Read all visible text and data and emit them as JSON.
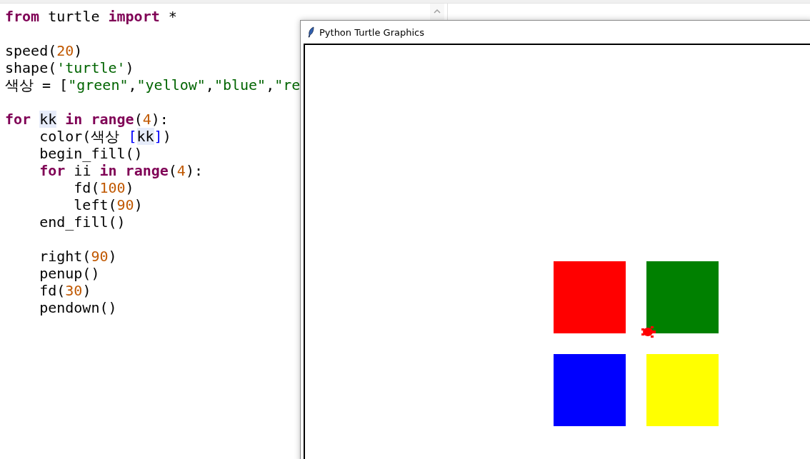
{
  "editor": {
    "blocks": [
      [
        [
          {
            "text": "from",
            "kind": "keyword"
          },
          {
            "text": " turtle ",
            "kind": "plain"
          },
          {
            "text": "import",
            "kind": "keyword"
          },
          {
            "text": " *",
            "kind": "plain"
          }
        ]
      ],
      [
        [
          {
            "text": "speed(",
            "kind": "plain"
          },
          {
            "text": "20",
            "kind": "number"
          },
          {
            "text": ")",
            "kind": "plain"
          }
        ],
        [
          {
            "text": "shape(",
            "kind": "plain"
          },
          {
            "text": "'turtle'",
            "kind": "string"
          },
          {
            "text": ")",
            "kind": "plain"
          }
        ],
        [
          {
            "text": "색상 = [",
            "kind": "plain"
          },
          {
            "text": "\"green\"",
            "kind": "string"
          },
          {
            "text": ",",
            "kind": "plain"
          },
          {
            "text": "\"yellow\"",
            "kind": "string"
          },
          {
            "text": ",",
            "kind": "plain"
          },
          {
            "text": "\"blue\"",
            "kind": "string"
          },
          {
            "text": ",",
            "kind": "plain"
          },
          {
            "text": "\"re",
            "kind": "string"
          }
        ]
      ],
      [
        [
          {
            "text": "for ",
            "kind": "keyword"
          },
          {
            "text": "kk",
            "kind": "match"
          },
          {
            "text": " in range",
            "kind": "keyword"
          },
          {
            "text": "(",
            "kind": "plain"
          },
          {
            "text": "4",
            "kind": "number"
          },
          {
            "text": "):",
            "kind": "plain"
          }
        ],
        [
          {
            "text": "    color(색상 ",
            "kind": "plain"
          },
          {
            "text": "[",
            "kind": "bracket"
          },
          {
            "text": "kk",
            "kind": "match"
          },
          {
            "text": "]",
            "kind": "bracket"
          },
          {
            "text": ")",
            "kind": "plain"
          }
        ],
        [
          {
            "text": "    begin_fill()",
            "kind": "plain"
          }
        ],
        [
          {
            "text": "    for",
            "kind": "keyword"
          },
          {
            "text": " ii ",
            "kind": "plain"
          },
          {
            "text": "in range",
            "kind": "keyword"
          },
          {
            "text": "(",
            "kind": "plain"
          },
          {
            "text": "4",
            "kind": "number"
          },
          {
            "text": "):",
            "kind": "plain"
          }
        ],
        [
          {
            "text": "        fd(",
            "kind": "plain"
          },
          {
            "text": "100",
            "kind": "number"
          },
          {
            "text": ")",
            "kind": "plain"
          }
        ],
        [
          {
            "text": "        left(",
            "kind": "plain"
          },
          {
            "text": "90",
            "kind": "number"
          },
          {
            "text": ")",
            "kind": "plain"
          }
        ],
        [
          {
            "text": "    end_fill()",
            "kind": "plain"
          }
        ]
      ],
      [
        [
          {
            "text": "    right(",
            "kind": "plain"
          },
          {
            "text": "90",
            "kind": "number"
          },
          {
            "text": ")",
            "kind": "plain"
          }
        ],
        [
          {
            "text": "    penup()",
            "kind": "plain"
          }
        ],
        [
          {
            "text": "    fd(",
            "kind": "plain"
          },
          {
            "text": "30",
            "kind": "number"
          },
          {
            "text": ")",
            "kind": "plain"
          }
        ],
        [
          {
            "text": "    pendown()",
            "kind": "plain"
          }
        ]
      ]
    ]
  },
  "turtle_window": {
    "title": "Python Turtle Graphics",
    "squares": [
      {
        "color": "#ff0000"
      },
      {
        "color": "#008000"
      },
      {
        "color": "#0000ff"
      },
      {
        "color": "#ffff00"
      }
    ],
    "turtle": {
      "color": "#ff0000"
    }
  }
}
